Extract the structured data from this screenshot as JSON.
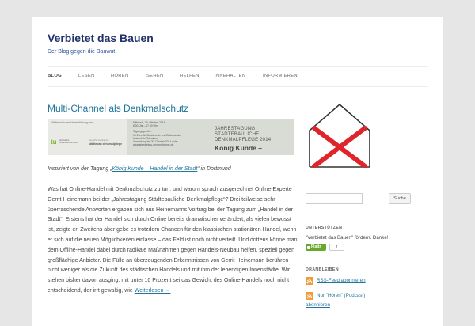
{
  "site": {
    "title": "Verbietet das Bauen",
    "description": "Der Blog gegen die Bauwut"
  },
  "nav": {
    "items": [
      {
        "label": "BLOG",
        "active": true
      },
      {
        "label": "LESEN"
      },
      {
        "label": "HÖREN"
      },
      {
        "label": "SEHEN"
      },
      {
        "label": "HELFEN"
      },
      {
        "label": "INNEHALTEN"
      },
      {
        "label": "INFORMIEREN"
      }
    ]
  },
  "post": {
    "title": "Multi-Channel als Denkmalschutz",
    "banner": {
      "thanks": "Mit freundlicher Unterstützung von:",
      "tu_logo": "tu",
      "tu_sub": "technische universität dortmund",
      "sponsor_sub": "Deutsche Vereinigung",
      "sponsor_logo": "städtebau denkmalpflege",
      "date": "Mittwoch, 29. Oktober 2014",
      "time": "8.00 Uhr – 17.00 Uhr",
      "fee_label": "Tagungsgebühr:",
      "fee_line1": "15 Euro für Studierende und Doktoranden",
      "fee_line2": "kostenfreie Teilnahme",
      "reg_line": "Anmeldung bis 20. Oktober 2014 unter",
      "reg_url": "www.staedtebau-denkmalpflege.de",
      "event_title_1": "JAHRESTAGUNG",
      "event_title_2": "STÄDTEBAULICHE",
      "event_title_3": "DENKMALPFLEGE 2014",
      "event_subtitle": "König Kunde –"
    },
    "intro_prefix": "Inspiriert von der Tagung „",
    "intro_link": "König Kunde – Handel in der Stadt",
    "intro_suffix": "“ in Dortmund",
    "body": "Was hat Online-Handel mit Denkmalschutz zu tun, und warum sprach ausgerechnet Online-Experte Gerrit Heinemann bei der „Jahrestagung Städtebauliche Denkmalpflege“? Drei teilweise sehr überraschende Antworten ergaben sich aus Heinemanns Vortrag bei der Tagung zum „Handel in der Stadt“: Erstens hat der Handel sich durch Online bereits dramatischer verändert, als vielen bewusst ist, zeigte er. Zweitens aber gebe es trotzdem Chancen für den klassischen stationären Handel, wenn er sich auf die neuen Möglichkeiten einlasse – das Feld ist noch nicht verteilt. Und drittens könne man dem Offline-Handel dabei durch radikale Maßnahmen gegen Handels-Neubau helfen, speziell gegen großflächige Anbieter. Die Fülle an überzeugenden Erkenntnissen von Gerrit Heinemann berühren nicht weniger als die Zukunft des städtischen Handels und mit ihm der lebendigen Innenstädte. Wir stehen bisher davon ausging, mit unter 10 Prozent sei das Gewicht des Online-Handels noch nicht entscheidend, der irrt gewaltig, wie ",
    "read_more": "Weiterlesen →"
  },
  "sidebar": {
    "search_placeholder": "",
    "search_button": "Suche",
    "support_title": "UNTERSTÜTZEN",
    "support_text": "\"Verbietet das Bauen\" fördern. Danke!",
    "flattr_label": "Flattr",
    "flattr_count": "1",
    "stay_title": "DRANBLEIBEN",
    "rss_feed": "RSS-Feed abonnieren",
    "podcast_line1": "Nur \"Hören\" (Podcast)",
    "podcast_line2": "abonnieren"
  },
  "colors": {
    "link": "#21759b",
    "title": "#21326b",
    "logo_cross": "#e0242b",
    "flattr": "#6aa72e",
    "rss": "#f19a38"
  }
}
